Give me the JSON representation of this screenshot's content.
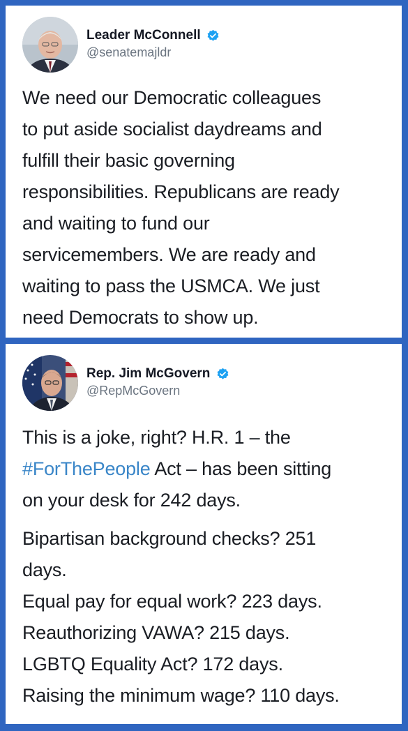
{
  "tweets": [
    {
      "display_name": "Leader McConnell",
      "handle": "@senatemajldr",
      "verified_icon": "verified-badge-icon",
      "text_lines": [
        "We need our Democratic colleagues",
        "to put aside socialist daydreams and",
        "fulfill their basic governing",
        "responsibilities. Republicans are ready",
        "and waiting to fund our",
        "servicemembers. We are ready and",
        "waiting to pass the USMCA. We just",
        "need Democrats to show up."
      ]
    },
    {
      "display_name": "Rep. Jim McGovern",
      "handle": "@RepMcGovern",
      "verified_icon": "verified-badge-icon",
      "line1": "This is a joke, right? H.R. 1 – the",
      "hashtag": "#ForThePeople",
      "line2_rest": " Act – has been sitting",
      "line3": "on your desk for 242 days.",
      "list_lines": [
        "Bipartisan background checks? 251",
        "days.",
        "Equal pay for equal work? 223 days.",
        "Reauthorizing VAWA? 215 days.",
        "LGBTQ Equality Act? 172 days.",
        "Raising the minimum wage? 110 days."
      ]
    }
  ],
  "colors": {
    "frame": "#2f65c0",
    "card": "#ffffff",
    "verified": "#1da1f2",
    "hashtag": "#3a86c8",
    "handle": "#6a7480"
  }
}
